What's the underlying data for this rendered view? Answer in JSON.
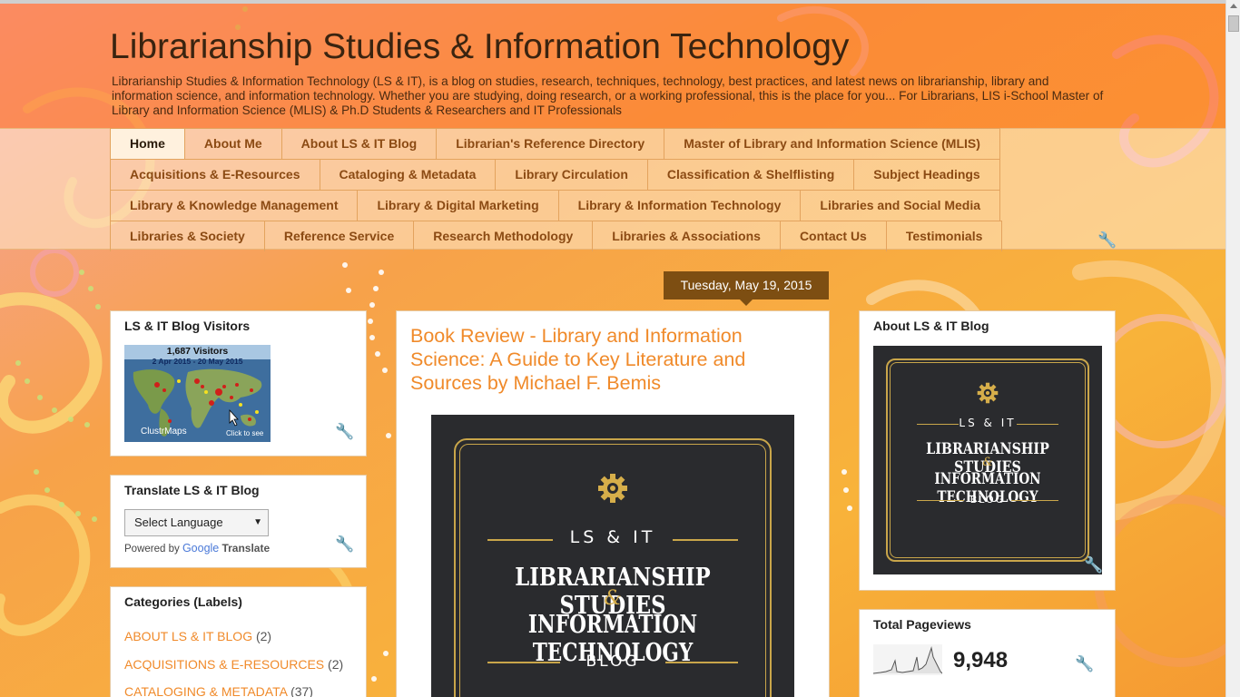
{
  "header": {
    "title": "Librarianship Studies & Information Technology",
    "description": "Librarianship Studies & Information Technology (LS & IT), is a blog on studies, research, techniques, technology, best practices, and latest news on librarianship, library and information science, and information technology. Whether you are studying, doing research, or a working professional, this is the place for you... For Librarians, LIS i-School Master of Library and Information Science (MLIS) & Ph.D Students & Researchers and IT Professionals"
  },
  "nav": {
    "row1": [
      "Home",
      "About Me",
      "About LS & IT Blog",
      "Librarian's Reference Directory",
      "Master of Library and Information Science (MLIS)"
    ],
    "row2": [
      "Acquisitions & E-Resources",
      "Cataloging & Metadata",
      "Library Circulation",
      "Classification & Shelflisting",
      "Subject Headings"
    ],
    "row3": [
      "Library & Knowledge Management",
      "Library & Digital Marketing",
      "Library & Information Technology",
      "Libraries and Social Media"
    ],
    "row4": [
      "Libraries & Society",
      "Reference Service",
      "Research Methodology",
      "Libraries & Associations",
      "Contact Us",
      "Testimonials"
    ]
  },
  "visitors": {
    "title": "LS & IT Blog Visitors",
    "count": "1,687  Visitors",
    "range": "2 Apr 2015 - 20 May 2015",
    "brand": "ClustrMaps",
    "cta": "Click to see"
  },
  "translate": {
    "title": "Translate LS & IT Blog",
    "select_value": "Select Language",
    "powered_by": "Powered by",
    "google": "Google",
    "translate_word": "Translate"
  },
  "categories": {
    "title": "Categories (Labels)",
    "items": [
      {
        "label": "ABOUT LS & IT BLOG",
        "count": "(2)"
      },
      {
        "label": "ACQUISITIONS & E-RESOURCES",
        "count": "(2)"
      },
      {
        "label": "CATALOGING & METADATA",
        "count": "(37)"
      }
    ]
  },
  "post": {
    "date": "Tuesday, May 19, 2015",
    "title": "Book Review - Library and Information Science: A Guide to Key Literature and Sources by Michael F. Bemis"
  },
  "logo": {
    "lsit": "LS & IT",
    "line1": "LIBRARIANSHIP STUDIES",
    "amp": "&",
    "line2": "INFORMATION TECHNOLOGY",
    "blog": "BLOG"
  },
  "about_widget": {
    "title": "About LS & IT Blog"
  },
  "pageviews": {
    "title": "Total Pageviews",
    "value": "9,948"
  },
  "colors": {
    "accent": "#f08a2a",
    "nav_text": "#8b4a13",
    "date_bg": "#7d4e12",
    "logo_bg": "#2a2b2e",
    "gold": "#c9a64a"
  },
  "icons": [
    "wrench-icon",
    "gear-icon",
    "globe-map-icon",
    "sparkline-icon",
    "cursor-arrow-icon"
  ]
}
